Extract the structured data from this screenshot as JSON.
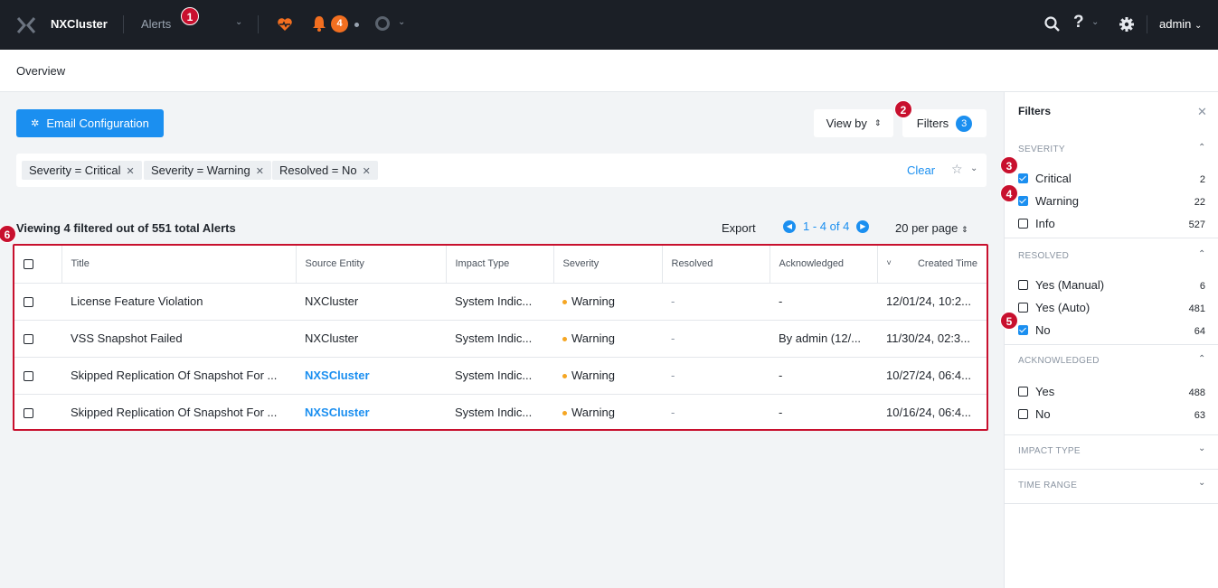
{
  "topbar": {
    "app_name": "NXCluster",
    "page_name": "Alerts",
    "alert_count": "4",
    "help": "?",
    "user": "admin"
  },
  "markers": [
    "1",
    "2",
    "3",
    "4",
    "5",
    "6"
  ],
  "breadcrumb": "Overview",
  "toolbar": {
    "email_config_label": "Email Configuration",
    "view_by_label": "View by",
    "filters_label": "Filters",
    "filters_count": "3"
  },
  "chips": [
    {
      "label": "Severity = Critical"
    },
    {
      "label": "Severity = Warning"
    },
    {
      "label": "Resolved = No"
    }
  ],
  "chip_bar": {
    "clear_label": "Clear"
  },
  "summary": "Viewing 4 filtered out of 551 total Alerts",
  "export_label": "Export",
  "pagination": {
    "range": "1 - 4 of 4",
    "per_page": "20 per page"
  },
  "table": {
    "columns": [
      "Title",
      "Source Entity",
      "Impact Type",
      "Severity",
      "Resolved",
      "Acknowledged",
      "Created Time"
    ],
    "rows": [
      {
        "title": "License Feature Violation",
        "source": "NXCluster",
        "source_link": false,
        "impact": "System Indic...",
        "severity": "Warning",
        "resolved": "-",
        "acknowledged": "-",
        "created": "12/01/24, 10:2..."
      },
      {
        "title": "VSS Snapshot Failed",
        "source": "NXCluster",
        "source_link": false,
        "impact": "System Indic...",
        "severity": "Warning",
        "resolved": "-",
        "acknowledged": "By admin (12/...",
        "created": "11/30/24, 02:3..."
      },
      {
        "title": "Skipped Replication Of Snapshot For ...",
        "source": "NXSCluster",
        "source_link": true,
        "impact": "System Indic...",
        "severity": "Warning",
        "resolved": "-",
        "acknowledged": "-",
        "created": "10/27/24, 06:4..."
      },
      {
        "title": "Skipped Replication Of Snapshot For ...",
        "source": "NXSCluster",
        "source_link": true,
        "impact": "System Indic...",
        "severity": "Warning",
        "resolved": "-",
        "acknowledged": "-",
        "created": "10/16/24, 06:4..."
      }
    ]
  },
  "filter_panel": {
    "title": "Filters",
    "severity": {
      "label": "SEVERITY",
      "options": [
        {
          "label": "Critical",
          "count": "2",
          "checked": true
        },
        {
          "label": "Warning",
          "count": "22",
          "checked": true
        },
        {
          "label": "Info",
          "count": "527",
          "checked": false
        }
      ]
    },
    "resolved": {
      "label": "RESOLVED",
      "options": [
        {
          "label": "Yes (Manual)",
          "count": "6",
          "checked": false
        },
        {
          "label": "Yes (Auto)",
          "count": "481",
          "checked": false
        },
        {
          "label": "No",
          "count": "64",
          "checked": true
        }
      ]
    },
    "acknowledged": {
      "label": "ACKNOWLEDGED",
      "options": [
        {
          "label": "Yes",
          "count": "488",
          "checked": false
        },
        {
          "label": "No",
          "count": "63",
          "checked": false
        }
      ]
    },
    "impact_type": {
      "label": "IMPACT TYPE"
    },
    "time_range": {
      "label": "TIME RANGE"
    }
  },
  "colors": {
    "accent": "#1b8ff0",
    "topbar": "#1b1f26",
    "warning": "#f5a623",
    "marker": "#c8102e",
    "alert_badge": "#f36f20"
  }
}
